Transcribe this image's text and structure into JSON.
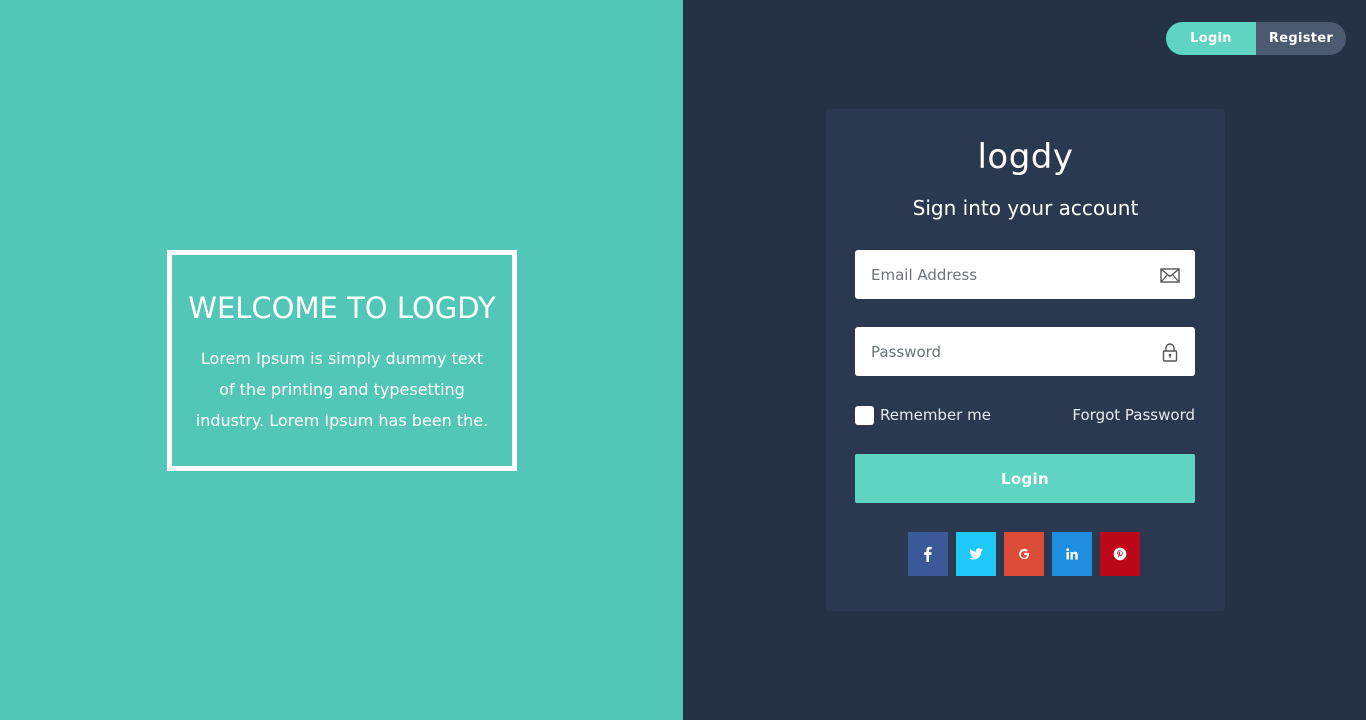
{
  "welcome": {
    "title": "WELCOME TO LOGDY",
    "text": "Lorem Ipsum is simply dummy text of the printing and typesetting industry. Lorem Ipsum has been the."
  },
  "nav": {
    "login_label": "Login",
    "register_label": "Register"
  },
  "form": {
    "logo": "logdy",
    "title": "Sign into your account",
    "email": {
      "placeholder": "Email Address",
      "value": "",
      "icon": "envelope-icon"
    },
    "password": {
      "placeholder": "Password",
      "value": "",
      "icon": "lock-icon"
    },
    "remember_label": "Remember me",
    "remember_checked": false,
    "forgot_label": "Forgot Password",
    "login_button": "Login"
  },
  "social": [
    {
      "name": "facebook",
      "icon": "facebook-icon",
      "color": "#3b5998"
    },
    {
      "name": "twitter",
      "icon": "twitter-icon",
      "color": "#1da1f2"
    },
    {
      "name": "google",
      "icon": "google-icon",
      "color": "#dd4b39"
    },
    {
      "name": "linkedin",
      "icon": "linkedin-icon",
      "color": "#0e76a8"
    },
    {
      "name": "pinterest",
      "icon": "pinterest-icon",
      "color": "#bd081c"
    }
  ],
  "colors": {
    "left_bg": "#52c7b8",
    "right_bg": "#253246",
    "card_bg": "#2b3950",
    "accent": "#5fd4c2",
    "register_bg": "#4b5a6f"
  }
}
